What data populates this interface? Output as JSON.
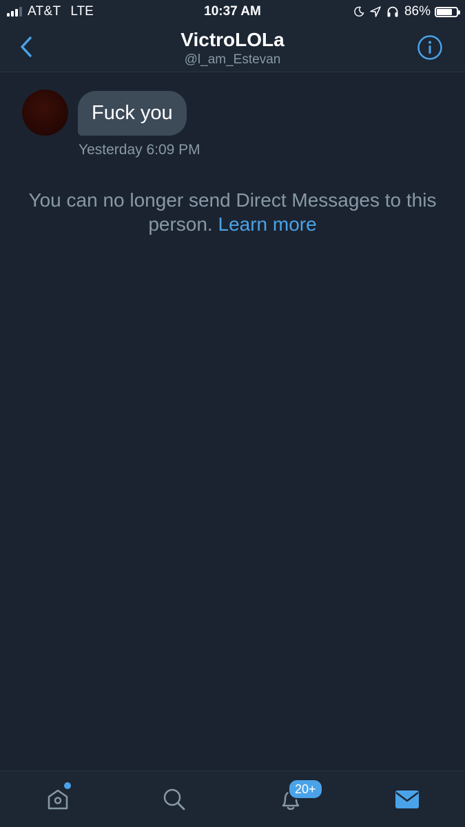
{
  "status_bar": {
    "carrier": "AT&T",
    "network": "LTE",
    "time": "10:37 AM",
    "battery_percent": "86%",
    "battery_level": 0.86,
    "signal_bars_active": 3,
    "signal_bars_total": 4,
    "icons": [
      "moon-icon",
      "location-arrow-icon",
      "headphones-icon"
    ]
  },
  "header": {
    "title": "VictroLOLa",
    "handle": "@l_am_Estevan",
    "back_icon": "chevron-left-icon",
    "info_icon": "info-icon"
  },
  "conversation": {
    "messages": [
      {
        "text": "Fuck you",
        "timestamp": "Yesterday 6:09 PM",
        "direction": "received"
      }
    ],
    "notice": {
      "text": "You can no longer send Direct Messages to this person.",
      "link": "Learn more"
    }
  },
  "tab_bar": {
    "tabs": [
      {
        "name": "home",
        "icon": "home-icon",
        "has_dot": true
      },
      {
        "name": "search",
        "icon": "search-icon"
      },
      {
        "name": "notifications",
        "icon": "bell-icon",
        "badge": "20+"
      },
      {
        "name": "messages",
        "icon": "envelope-icon",
        "active": true
      }
    ]
  },
  "colors": {
    "background": "#1b2330",
    "bar": "#1d2633",
    "accent": "#4aa3e8",
    "bubble": "#3d4a58",
    "secondary_text": "#8899a6"
  }
}
